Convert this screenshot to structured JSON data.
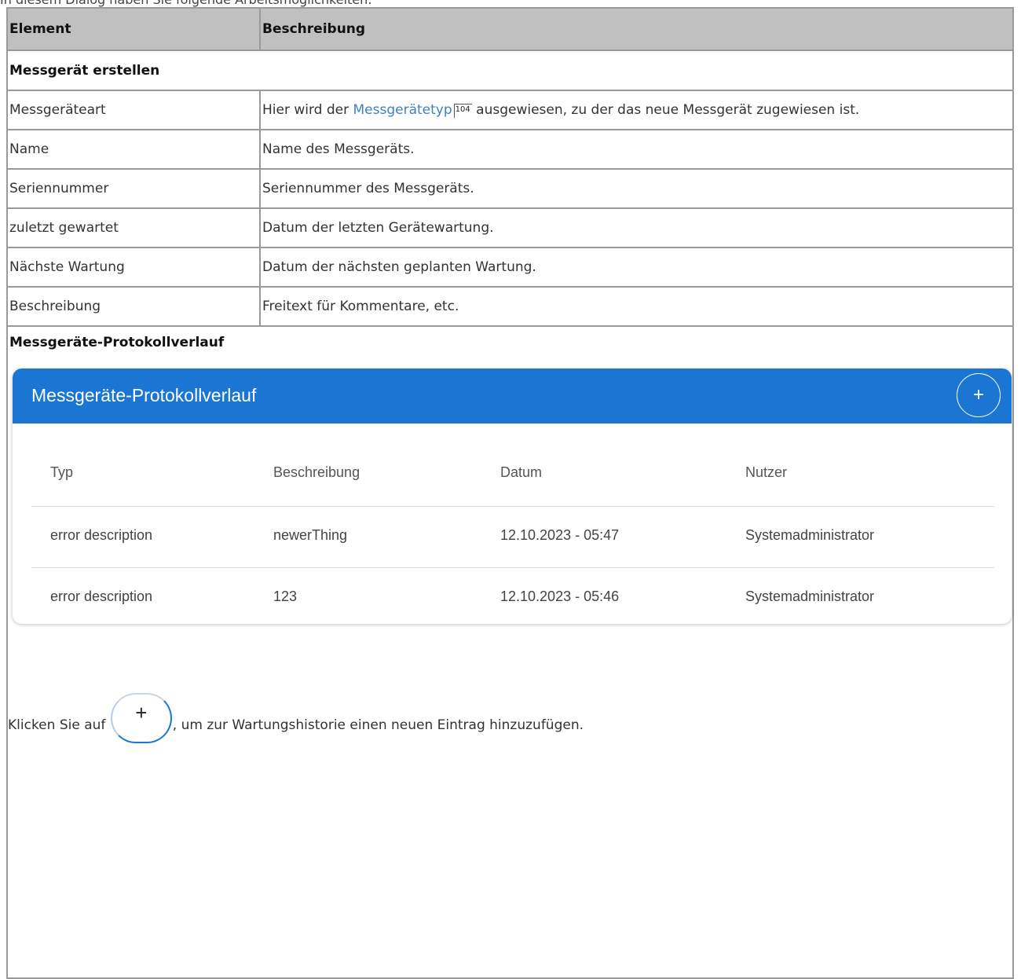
{
  "intro_text": "In diesem Dialog haben Sie folgende Arbeitsmöglichkeiten:",
  "table": {
    "header": {
      "element": "Element",
      "description": "Beschreibung"
    },
    "section1_title": "Messgerät erstellen",
    "rows": [
      {
        "element": "Messgeräteart",
        "desc_before": "Hier wird der ",
        "desc_link": "Messgerätetyp",
        "desc_ref": "104",
        "desc_after": " ausgewiesen, zu der das neue Messgerät zugewiesen ist."
      },
      {
        "element": "Name",
        "desc": "Name des Messgeräts."
      },
      {
        "element": "Seriennummer",
        "desc": "Seriennummer des Messgeräts."
      },
      {
        "element": "zuletzt gewartet",
        "desc": "Datum der letzten Gerätewartung."
      },
      {
        "element": "Nächste Wartung",
        "desc": "Datum der nächsten geplanten Wartung."
      },
      {
        "element": "Beschreibung",
        "desc": "Freitext für Kommentare, etc."
      }
    ],
    "section2_title": "Messgeräte-Protokollverlauf"
  },
  "panel": {
    "title": "Messgeräte-Protokollverlauf",
    "add_icon": "plus-icon",
    "add_label": "+",
    "columns": [
      "Typ",
      "Beschreibung",
      "Datum",
      "Nutzer"
    ],
    "rows": [
      [
        "error description",
        "newerThing",
        "12.10.2023 - 05:47",
        "Systemadministrator"
      ],
      [
        "error description",
        "123",
        "12.10.2023 - 05:46",
        "Systemadministrator"
      ]
    ],
    "header_color": "#1a76d2"
  },
  "instruction": {
    "before": "Klicken Sie auf ",
    "button_label": "+",
    "after": ", um zur Wartungshistorie einen neuen Eintrag hinzuzufügen."
  }
}
